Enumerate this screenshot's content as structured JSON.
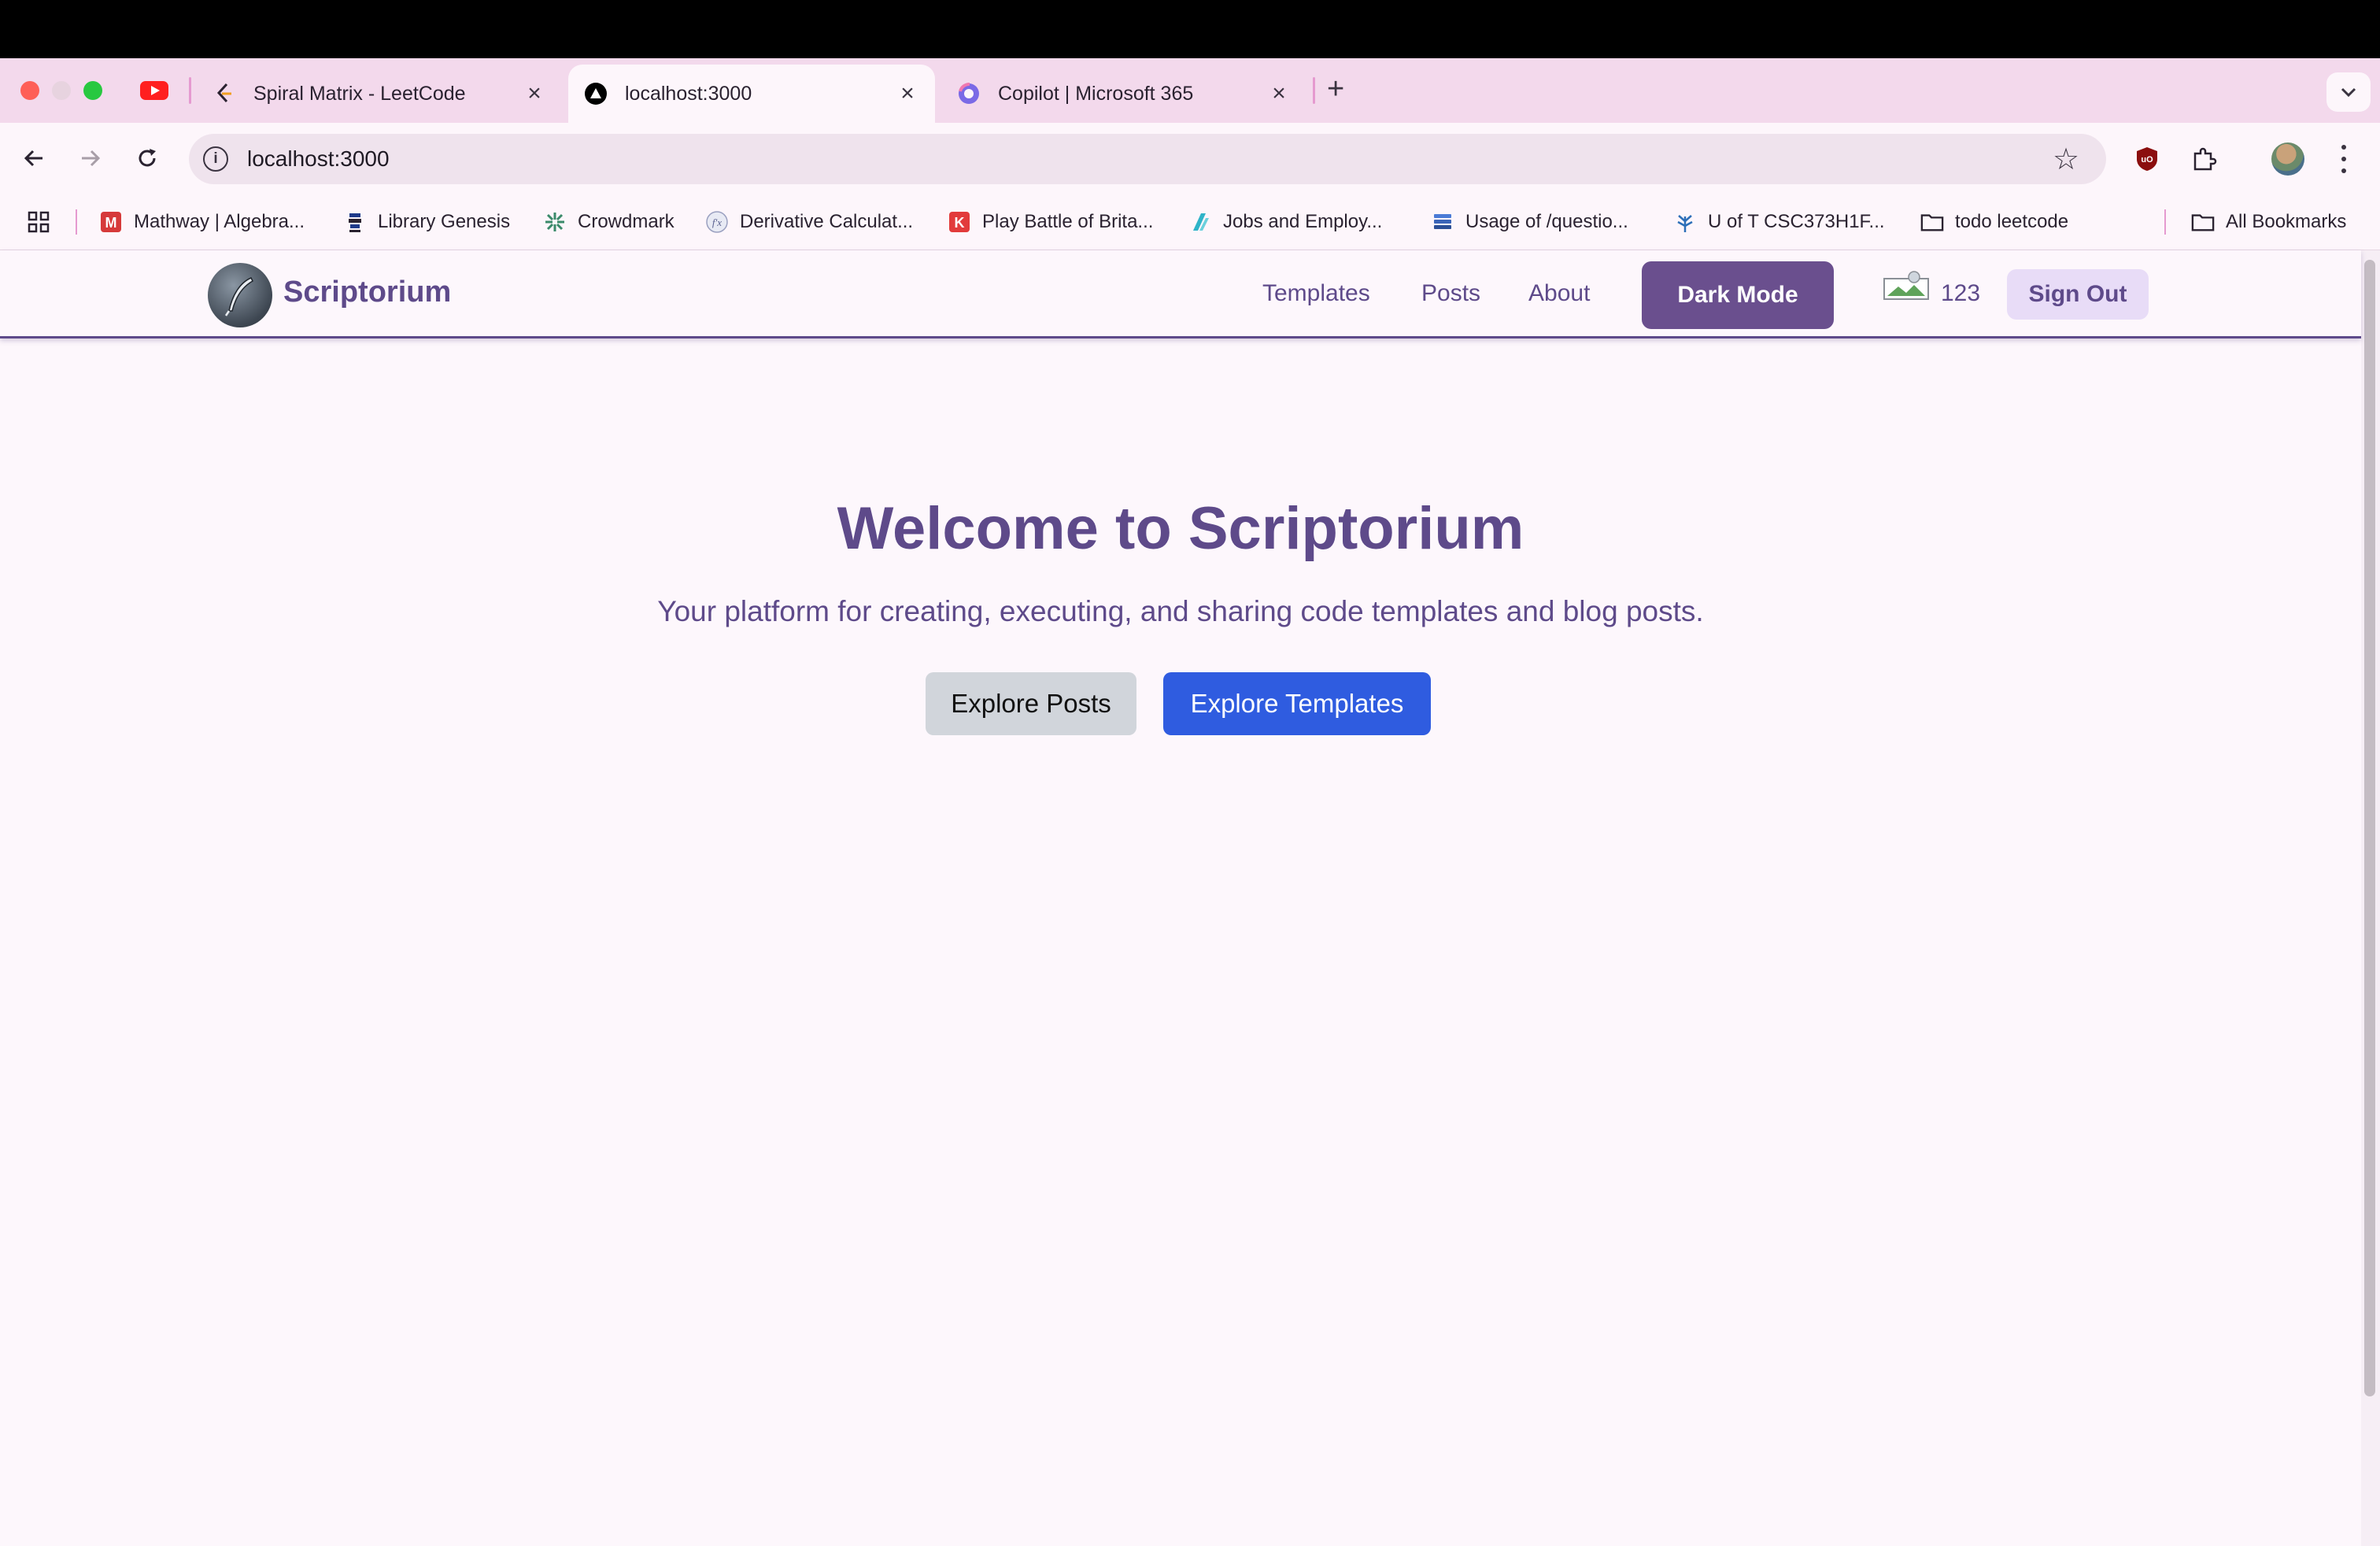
{
  "browser": {
    "tabs": [
      {
        "title": "Spiral Matrix - LeetCode",
        "close": "×"
      },
      {
        "title": "localhost:3000",
        "close": "×"
      },
      {
        "title": "Copilot | Microsoft 365",
        "close": "×"
      }
    ],
    "new_tab": "+",
    "address": "localhost:3000",
    "info_glyph": "i",
    "star_glyph": "☆",
    "bookmarks": [
      {
        "label": "Mathway | Algebra..."
      },
      {
        "label": "Library Genesis"
      },
      {
        "label": "Crowdmark"
      },
      {
        "label": "Derivative Calculat..."
      },
      {
        "label": "Play Battle of Brita..."
      },
      {
        "label": "Jobs and Employ..."
      },
      {
        "label": "Usage of /questio..."
      },
      {
        "label": "U of T CSC373H1F..."
      },
      {
        "label": "todo leetcode"
      }
    ],
    "all_bookmarks": "All Bookmarks"
  },
  "app": {
    "brand": "Scriptorium",
    "nav": {
      "templates": "Templates",
      "posts": "Posts",
      "about": "About"
    },
    "dark_mode_label": "Dark Mode",
    "user_points": "123",
    "sign_out_label": "Sign Out"
  },
  "hero": {
    "title": "Welcome to Scriptorium",
    "subtitle": "Your platform for creating, executing, and sharing code templates and blog posts.",
    "explore_posts": "Explore Posts",
    "explore_templates": "Explore Templates"
  },
  "colors": {
    "brand_purple": "#5e4a8a",
    "primary_blue": "#2f5ce0",
    "page_bg": "#fdf7fc",
    "tabstrip_bg": "#f3d9ec"
  }
}
